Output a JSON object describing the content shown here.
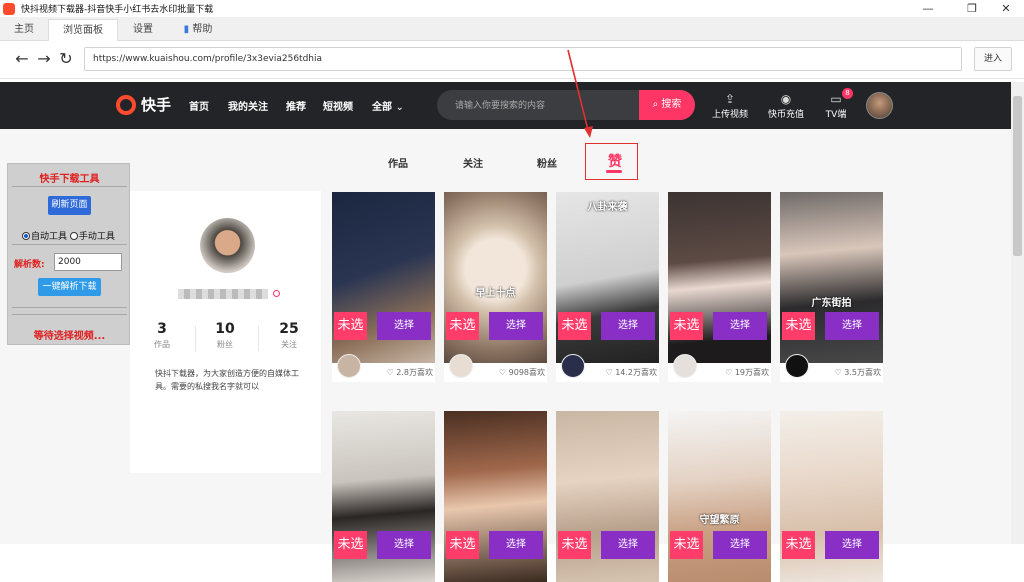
{
  "window": {
    "title": "快抖视频下载器-抖音快手小红书去水印批量下载",
    "controls": [
      "—",
      "❐",
      "✕"
    ]
  },
  "tabs": [
    {
      "label": "主页"
    },
    {
      "label": "浏览面板"
    },
    {
      "label": "设置"
    },
    {
      "label": "帮助"
    }
  ],
  "nav": {
    "url": "https://www.kuaishou.com/profile/3x3evia256tdhia",
    "go_label": "进入"
  },
  "site": {
    "logo": "快手",
    "menu": [
      "首页",
      "我的关注",
      "推荐",
      "短视频",
      "全部"
    ],
    "search_placeholder": "请输入你要搜索的内容",
    "search_button": "搜索",
    "icons": [
      {
        "label": "上传视频",
        "icon": "upload-icon"
      },
      {
        "label": "快币充值",
        "icon": "coin-icon"
      },
      {
        "label": "TV端",
        "icon": "tv-icon"
      }
    ],
    "tv_badge": "8"
  },
  "profile_tabs": [
    "作品",
    "关注",
    "粉丝",
    "赞"
  ],
  "tool": {
    "title": "快手下载工具",
    "refresh_label": "刷新页面",
    "radio_auto": "自动工具",
    "radio_manual": "手动工具",
    "count_label": "解析数:",
    "count_value": "2000",
    "parse_label": "一键解析下载",
    "status": "等待选择视频..."
  },
  "profile": {
    "stats": [
      {
        "value": "3",
        "label": "作品"
      },
      {
        "value": "10",
        "label": "粉丝"
      },
      {
        "value": "25",
        "label": "关注"
      }
    ],
    "description": "快抖下载器，为大家创造方便的自媒体工具。需要的私搜我名字就可以"
  },
  "video_labels": {
    "unselected": "未选",
    "select": "选择"
  },
  "videos": [
    {
      "caption": "",
      "likes": "2.8万喜欢",
      "bg": "linear-gradient(160deg,#1b2740 0%,#2a3552 45%,#8a6e58 75%,#c7b7a6 100%)"
    },
    {
      "caption": "早上十点",
      "likes": "9098喜欢",
      "bg": "radial-gradient(circle at 50% 45%,#f2e6da 0 28%,#d4c2ad 40%,#8d7563 75%,#5a4a40 100%)"
    },
    {
      "caption": "八卦来袭",
      "likes": "14.2万喜欢",
      "bg": "linear-gradient(170deg,#e6e6e6 0%,#cfcfcf 50%,#3a3a3a 70%,#222 100%)"
    },
    {
      "caption": "",
      "likes": "19万喜欢",
      "bg": "linear-gradient(175deg,#3c3432 0%,#5d4a44 40%,#e8d8d0 55%,#1d1b1c 85%)"
    },
    {
      "caption": "广东街拍",
      "likes": "3.5万喜欢",
      "bg": "linear-gradient(175deg,#6f6a68 0%,#d9c6ba 35%,#2b2a2c 65%,#494849 100%)"
    },
    {
      "caption": "",
      "likes": "",
      "bg": "linear-gradient(175deg,#e9e7e3 0%,#c9c4bd 40%,#2a2624 60%,#ddd8d2 100%)"
    },
    {
      "caption": "",
      "likes": "",
      "bg": "linear-gradient(175deg,#4a2f22 0%,#a0684c 35%,#e8c7ad 55%,#3b2a20 100%)"
    },
    {
      "caption": "",
      "likes": "",
      "bg": "linear-gradient(175deg,#c9b7a4 0%,#e6d3c1 40%,#b7a08c 70%,#d7c5b2 100%)"
    },
    {
      "caption": "守望繁原",
      "likes": "",
      "bg": "linear-gradient(175deg,#f4f4f4 0%,#e4d2c4 40%,#c89f82 70%,#b88c6d 100%)"
    },
    {
      "caption": "",
      "likes": "",
      "bg": "linear-gradient(175deg,#f3efe9 0%,#e8d7c9 40%,#d8c0ab 70%,#eee6de 100%)"
    }
  ],
  "colors": {
    "accent": "#fe3666",
    "purple": "#8a2fc6",
    "tool_red": "#e02020"
  }
}
